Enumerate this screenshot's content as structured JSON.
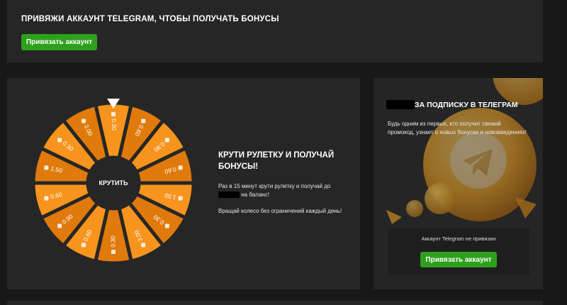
{
  "top_banner": {
    "title": "ПРИВЯЖИ АККАУНТ TELEGRAM, ЧТОБЫ ПОЛУЧАТЬ БОНУСЫ",
    "button_label": "Привязать аккаунт"
  },
  "wheel": {
    "center_label": "КРУТИТЬ",
    "segments": [
      "0.30",
      "0.60",
      "0.90",
      "0.60",
      "1.50",
      "0.30",
      "3.00",
      "0.30",
      "0.60",
      "0.90",
      "0.60",
      "1.50",
      "0.30",
      "3.00"
    ],
    "colors": {
      "segment": "#f7941d",
      "segment_dark": "#e07a0c",
      "divider": "#262626",
      "hub": "#262626"
    },
    "title": "КРУТИ РУЛЕТКУ И ПОЛУЧАЙ БОНУСЫ!",
    "desc_before": "Раз в 15 минут крути рулетку и получай до",
    "desc_after": "на баланс!",
    "desc2": "Вращай колесо без ограничений каждый день!"
  },
  "telegram_card": {
    "title": "ЗА ПОДПИСКУ В ТЕЛЕГРАМ",
    "description": "Будь одним из первых, кто получит свежий промокод, узнает о новых бонусах и нововведениях!",
    "status": "Аккаунт Telegram не привязан",
    "button_label": "Привязать аккаунт",
    "icon": "telegram-plane-icon"
  },
  "colors": {
    "accent_green": "#2ea01d",
    "panel": "#262626",
    "background": "#181818"
  }
}
